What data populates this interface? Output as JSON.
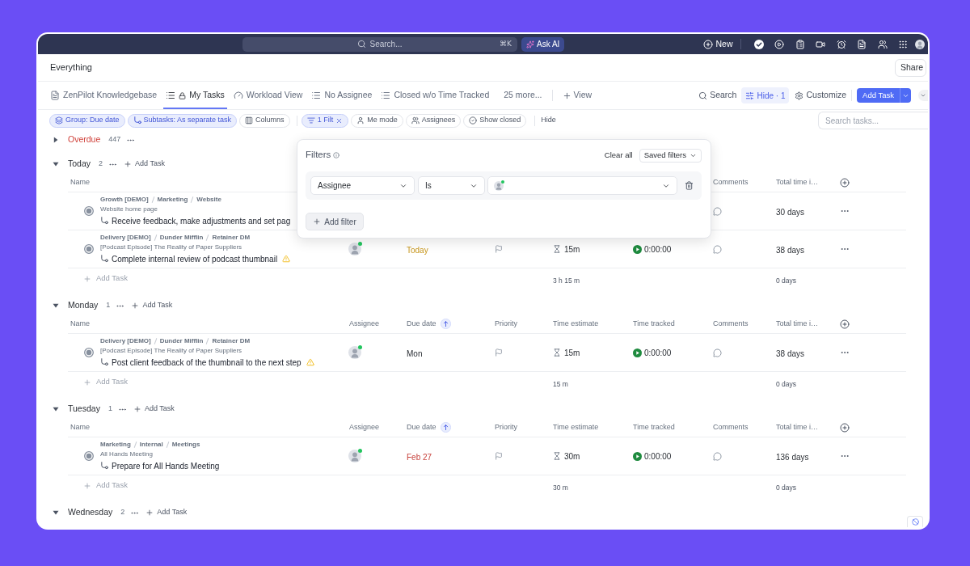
{
  "topbar": {
    "search_placeholder": "Search...",
    "shortcut": "⌘K",
    "ask_ai": "Ask AI",
    "new": "New"
  },
  "header": {
    "title": "Everything",
    "share": "Share"
  },
  "tabs": [
    {
      "label": "ZenPilot Knowledgebase",
      "kind": "doc",
      "locked": false,
      "selected": false
    },
    {
      "label": "My Tasks",
      "kind": "list",
      "locked": true,
      "selected": true
    },
    {
      "label": "Workload View",
      "kind": "workload",
      "locked": false,
      "selected": false
    },
    {
      "label": "No Assignee",
      "kind": "list",
      "locked": false,
      "selected": false
    },
    {
      "label": "Closed w/o Time Tracked",
      "kind": "list",
      "locked": false,
      "selected": false
    }
  ],
  "more_views": "25 more...",
  "add_view": "View",
  "view_actions": {
    "search": "Search",
    "hide": "Hide · 1",
    "customize": "Customize",
    "add_task": "Add Task"
  },
  "view_chips": [
    {
      "label": "Group: Due date",
      "kind": "group",
      "active": true,
      "removable": false
    },
    {
      "label": "Subtasks: As separate task",
      "kind": "subtasks",
      "active": true,
      "removable": false
    },
    {
      "label": "Columns",
      "kind": "columns",
      "active": false,
      "removable": false
    }
  ],
  "filter_chips": [
    {
      "label": "1 Filt",
      "kind": "filter",
      "active": true,
      "removable": true
    },
    {
      "label": "Me mode",
      "kind": "me",
      "active": false,
      "removable": false
    },
    {
      "label": "Assignees",
      "kind": "assignees",
      "active": false,
      "removable": false
    },
    {
      "label": "Show closed",
      "kind": "closed",
      "active": false,
      "removable": false
    }
  ],
  "hide_link": "Hide",
  "task_search": {
    "placeholder": "Search tasks..."
  },
  "groups": [
    {
      "title": "Overdue",
      "kind": "overdue",
      "expanded": false,
      "count": "447"
    },
    {
      "title": "Today",
      "kind": "day",
      "expanded": true,
      "count": "2",
      "add_task": "Add Task",
      "columns": [
        {
          "kind": "name",
          "label": "Name",
          "sorted": false
        },
        {
          "kind": "comments",
          "label": "Comments",
          "sorted": false
        },
        {
          "kind": "total_time",
          "label": "Total time i…",
          "sorted": false
        }
      ],
      "tasks": [
        {
          "path": [
            "Growth [DEMO]",
            "Marketing",
            "Website"
          ],
          "parent": "Website home page",
          "title": "Receive feedback, make adjustments and set pag",
          "warning": false,
          "has_comments": false,
          "total_time": "30 days"
        },
        {
          "path": [
            "Delivery [DEMO]",
            "Dunder Mifflin",
            "Retainer DM"
          ],
          "parent": "[Podcast Episode] The Reality of Paper Suppliers",
          "title": "Complete internal review of podcast thumbnail",
          "warning": true,
          "assignee": {
            "online": true
          },
          "due": {
            "text": "Today",
            "kind": "today"
          },
          "priority_set": false,
          "estimate": "15m",
          "tracked": "0:00:00",
          "has_comments": false,
          "total_time": "38 days"
        }
      ],
      "footer": {
        "add_task": "Add Task",
        "estimate_total": "3 h 15 m",
        "time_total": "0 days"
      }
    },
    {
      "title": "Monday",
      "kind": "day",
      "expanded": true,
      "count": "1",
      "add_task": "Add Task",
      "columns": [
        {
          "kind": "name",
          "label": "Name",
          "sorted": false
        },
        {
          "kind": "assignee",
          "label": "Assignee",
          "sorted": false
        },
        {
          "kind": "due_date",
          "label": "Due date",
          "sorted": true
        },
        {
          "kind": "priority",
          "label": "Priority",
          "sorted": false
        },
        {
          "kind": "estimate",
          "label": "Time estimate",
          "sorted": false
        },
        {
          "kind": "tracked",
          "label": "Time tracked",
          "sorted": false
        },
        {
          "kind": "comments",
          "label": "Comments",
          "sorted": false
        },
        {
          "kind": "total_time",
          "label": "Total time i…",
          "sorted": false
        }
      ],
      "tasks": [
        {
          "path": [
            "Delivery [DEMO]",
            "Dunder Mifflin",
            "Retainer DM"
          ],
          "parent": "[Podcast Episode] The Reality of Paper Suppliers",
          "title": "Post client feedback of the thumbnail to the next step",
          "warning": true,
          "assignee": {
            "online": true
          },
          "due": {
            "text": "Mon",
            "kind": "upcoming"
          },
          "priority_set": false,
          "estimate": "15m",
          "tracked": "0:00:00",
          "has_comments": false,
          "total_time": "38 days"
        }
      ],
      "footer": {
        "add_task": "Add Task",
        "estimate_total": "15 m",
        "time_total": "0 days"
      }
    },
    {
      "title": "Tuesday",
      "kind": "day",
      "expanded": true,
      "count": "1",
      "add_task": "Add Task",
      "columns": [
        {
          "kind": "name",
          "label": "Name",
          "sorted": false
        },
        {
          "kind": "assignee",
          "label": "Assignee",
          "sorted": false
        },
        {
          "kind": "due_date",
          "label": "Due date",
          "sorted": true
        },
        {
          "kind": "priority",
          "label": "Priority",
          "sorted": false
        },
        {
          "kind": "estimate",
          "label": "Time estimate",
          "sorted": false
        },
        {
          "kind": "tracked",
          "label": "Time tracked",
          "sorted": false
        },
        {
          "kind": "comments",
          "label": "Comments",
          "sorted": false
        },
        {
          "kind": "total_time",
          "label": "Total time i…",
          "sorted": false
        }
      ],
      "tasks": [
        {
          "path": [
            "Marketing",
            "Internal",
            "Meetings"
          ],
          "parent": "All Hands Meeting",
          "title": "Prepare for All Hands Meeting",
          "warning": false,
          "assignee": {
            "online": true
          },
          "due": {
            "text": "Feb 27",
            "kind": "overdue"
          },
          "priority_set": false,
          "estimate": "30m",
          "tracked": "0:00:00",
          "has_comments": false,
          "total_time": "136 days"
        }
      ],
      "footer": {
        "add_task": "Add Task",
        "estimate_total": "30 m",
        "time_total": "0 days"
      }
    },
    {
      "title": "Wednesday",
      "kind": "day",
      "expanded": true,
      "count": "2",
      "add_task": "Add Task"
    }
  ],
  "filter_popup": {
    "title": "Filters",
    "clear_all": "Clear all",
    "saved_filters": "Saved filters",
    "rules": [
      {
        "field": "Assignee",
        "operator": "Is",
        "value": {
          "online": true
        }
      }
    ],
    "add_filter": "Add filter"
  }
}
